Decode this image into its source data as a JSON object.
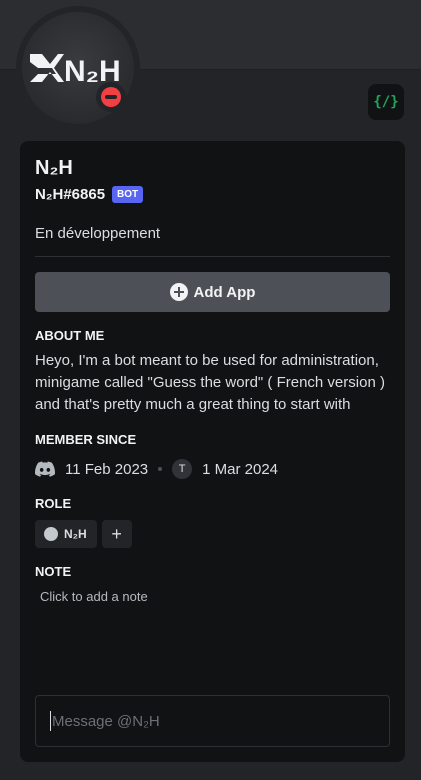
{
  "profile": {
    "display_name": "N₂H",
    "username": "N₂H#6865",
    "bot_tag": "BOT",
    "custom_status": "En développement",
    "avatar_text": "N₂H",
    "status": "do-not-disturb",
    "dev_badge_icon": "active-developer-badge-icon"
  },
  "actions": {
    "add_app_label": "Add App"
  },
  "about": {
    "title": "About Me",
    "text": "Heyo, I'm a bot meant to be used for administration, minigame called \"Guess the word\" ( French version ) and that's pretty much a great thing to start with"
  },
  "member_since": {
    "title": "Member Since",
    "discord_date": "11 Feb 2023",
    "server_initial": "T",
    "server_date": "1 Mar 2024"
  },
  "roles": {
    "title": "Role",
    "items": [
      {
        "name": "N₂H",
        "color": "#c4c9ce"
      }
    ],
    "add_label": "+"
  },
  "note": {
    "title": "Note",
    "placeholder": "Click to add a note"
  },
  "message": {
    "placeholder": "Message @N₂H"
  },
  "colors": {
    "background": "#232428",
    "card": "#111214",
    "bot_tag": "#5865f2",
    "dnd_status": "#f23f43",
    "dev_badge": "#23a55a"
  }
}
